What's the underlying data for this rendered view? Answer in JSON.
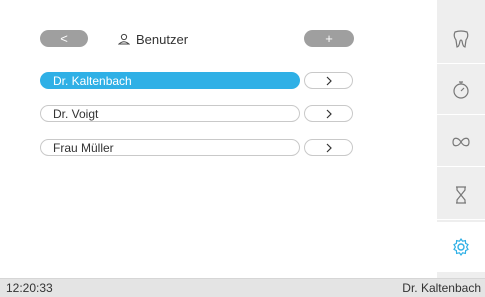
{
  "header": {
    "back_label": "<",
    "title": "Benutzer",
    "add_label": "+"
  },
  "users": [
    {
      "name": "Dr. Kaltenbach",
      "selected": true
    },
    {
      "name": "Dr. Voigt",
      "selected": false
    },
    {
      "name": "Frau Müller",
      "selected": false
    }
  ],
  "sidebar": {
    "items": [
      {
        "icon": "tooth-icon"
      },
      {
        "icon": "stopwatch-icon"
      },
      {
        "icon": "infinity-icon"
      },
      {
        "icon": "hourglass-icon"
      },
      {
        "icon": "gear-icon",
        "active": true
      }
    ]
  },
  "status": {
    "time": "12:20:33",
    "user": "Dr. Kaltenbach"
  },
  "colors": {
    "accent": "#2fb0e6",
    "button_gray": "#9f9f9f",
    "sidebar_bg": "#eeeeee",
    "status_bg": "#e4e4e4"
  }
}
